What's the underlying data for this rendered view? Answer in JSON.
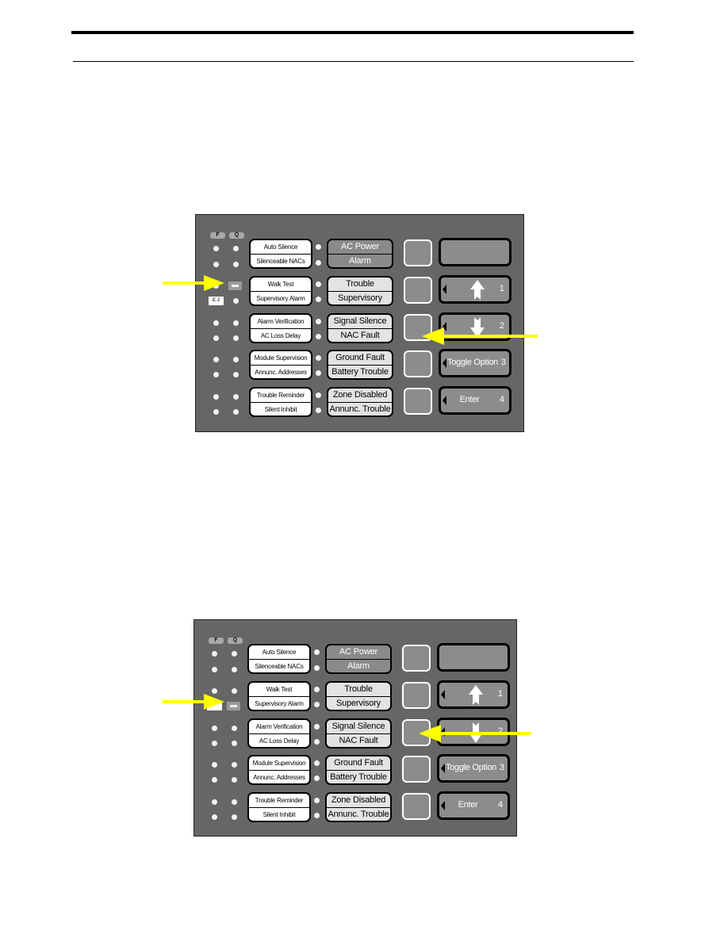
{
  "panels": [
    {
      "id": "panel-top",
      "fq_labels": [
        "F",
        "Q"
      ],
      "indicator_note": "E J",
      "function_labels": [
        [
          "Auto Silence",
          "Silenceable NACs"
        ],
        [
          "Walk Test",
          "Supervisory Alarm"
        ],
        [
          "Alarm Verification",
          "AC Loss Delay"
        ],
        [
          "Module Supervision",
          "Annunc. Addresses"
        ],
        [
          "Trouble Reminder",
          "Silent Inhibit"
        ]
      ],
      "status_labels": [
        [
          "AC Power",
          "Alarm"
        ],
        [
          "Trouble",
          "Supervisory"
        ],
        [
          "Signal Silence",
          "NAC Fault"
        ],
        [
          "Ground Fault",
          "Battery Trouble"
        ],
        [
          "Zone Disabled",
          "Annunc. Trouble"
        ]
      ],
      "keys": [
        {
          "label": "",
          "number": ""
        },
        {
          "label": "",
          "number": "1",
          "icon": "arrow-up"
        },
        {
          "label": "",
          "number": "2",
          "icon": "arrow-down"
        },
        {
          "label": "Toggle Option",
          "number": "3"
        },
        {
          "label": "Enter",
          "number": "4"
        }
      ]
    },
    {
      "id": "panel-bottom",
      "fq_labels": [
        "F",
        "Q"
      ],
      "function_labels": [
        [
          "Auto Silence",
          "Silenceable NACs"
        ],
        [
          "Walk Test",
          "Supervisory Alarm"
        ],
        [
          "Alarm Verification",
          "AC Loss Delay"
        ],
        [
          "Module Supervision",
          "Annunc. Addresses"
        ],
        [
          "Trouble Reminder",
          "Silent Inhibit"
        ]
      ],
      "status_labels": [
        [
          "AC Power",
          "Alarm"
        ],
        [
          "Trouble",
          "Supervisory"
        ],
        [
          "Signal Silence",
          "NAC Fault"
        ],
        [
          "Ground Fault",
          "Battery Trouble"
        ],
        [
          "Zone Disabled",
          "Annunc. Trouble"
        ]
      ],
      "keys": [
        {
          "label": "",
          "number": ""
        },
        {
          "label": "",
          "number": "1",
          "icon": "arrow-up"
        },
        {
          "label": "",
          "number": "2",
          "icon": "arrow-down"
        },
        {
          "label": "Toggle Option",
          "number": "3"
        },
        {
          "label": "Enter",
          "number": "4"
        }
      ]
    }
  ],
  "colors": {
    "panel": "#666666",
    "callout_arrow": "#ffff00"
  }
}
